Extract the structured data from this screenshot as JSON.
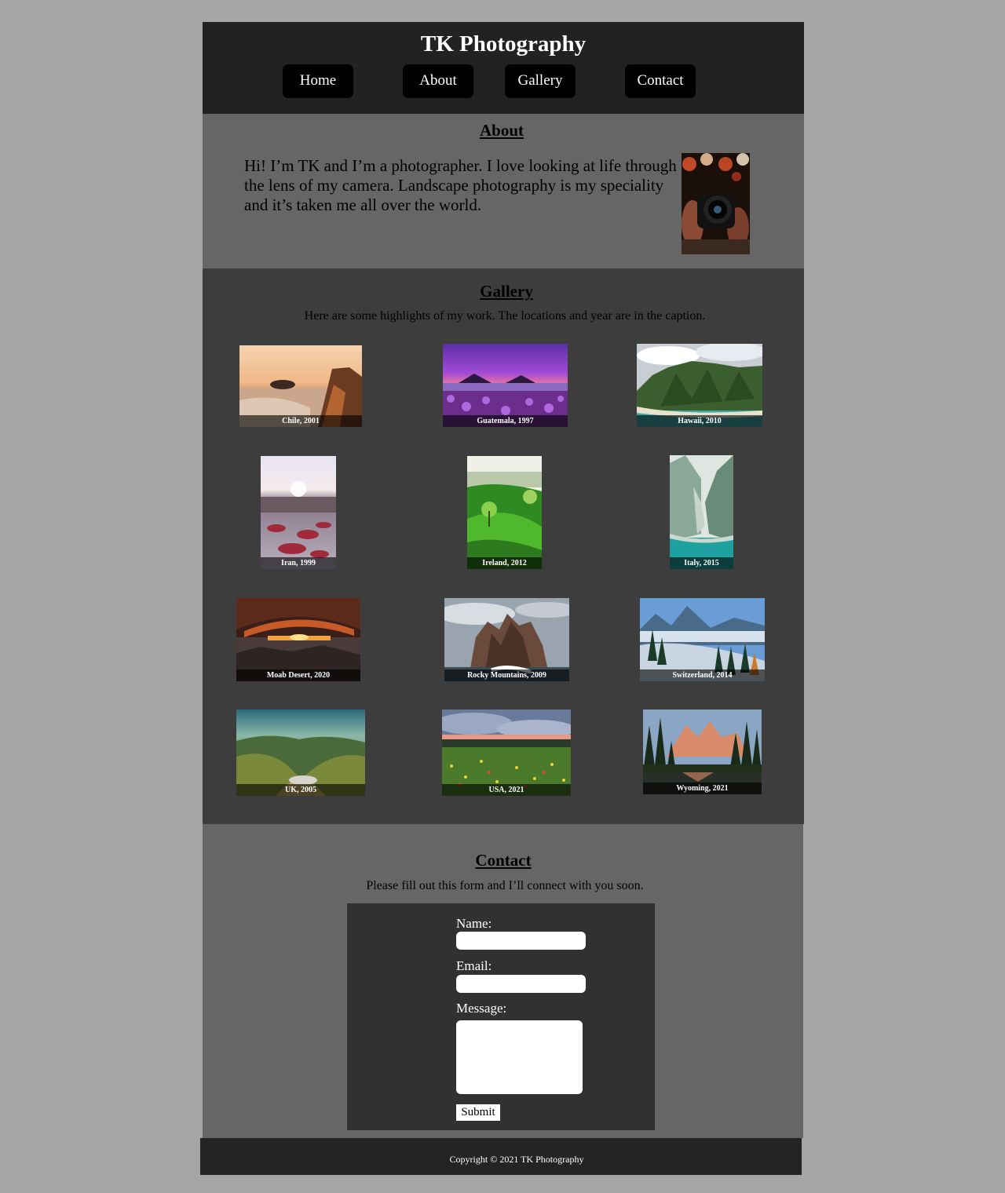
{
  "header": {
    "title": "TK Photography",
    "nav": [
      "Home",
      "About",
      "Gallery",
      "Contact"
    ]
  },
  "about": {
    "heading": "About",
    "text": "Hi! I’m TK and I’m a photographer. I love looking at life through the lens of my camera. Landscape photography is my speciality and it’s taken me all over the world."
  },
  "gallery": {
    "heading": "Gallery",
    "subtitle": "Here are some highlights of my work. The locations and year are in the caption.",
    "items": [
      {
        "caption": "Chile, 2001"
      },
      {
        "caption": "Guatemala, 1997"
      },
      {
        "caption": "Hawaii, 2010"
      },
      {
        "caption": "Iran, 1999"
      },
      {
        "caption": "Ireland, 2012"
      },
      {
        "caption": "Italy, 2015"
      },
      {
        "caption": "Moab Desert, 2020"
      },
      {
        "caption": "Rocky Mountains, 2009"
      },
      {
        "caption": "Switzerland, 2014"
      },
      {
        "caption": "UK, 2005"
      },
      {
        "caption": "USA, 2021"
      },
      {
        "caption": "Wyoming, 2021"
      }
    ]
  },
  "contact": {
    "heading": "Contact",
    "subtitle": "Please fill out this form and I’ll connect with you soon.",
    "name_label": "Name:",
    "email_label": "Email:",
    "message_label": "Message:",
    "name_value": "",
    "email_value": "",
    "message_value": "",
    "submit_label": "Submit"
  },
  "footer": {
    "copyright": "Copyright © 2021 TK Photography"
  },
  "colors": {
    "page_bg": "#a5a5a5",
    "header_bg": "#222222",
    "about_bg": "#666666",
    "gallery_bg": "#3d3d3d",
    "form_bg": "#313131",
    "footer_bg": "#242424"
  }
}
